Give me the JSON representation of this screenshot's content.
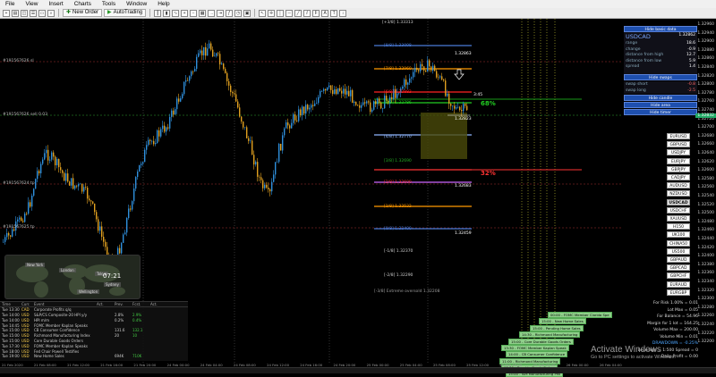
{
  "menu": [
    "File",
    "View",
    "Insert",
    "Charts",
    "Tools",
    "Window",
    "Help"
  ],
  "toolbar": {
    "new_order": "New Order",
    "autotrading": "AutoTrading"
  },
  "prices": [
    "1.32960",
    "1.32940",
    "1.32900",
    "1.32880",
    "1.32860",
    "1.32840",
    "1.32820",
    "1.32800",
    "1.32780",
    "1.32760",
    "1.32740",
    "1.32720",
    "1.32700",
    "1.32680",
    "1.32660",
    "1.32640",
    "1.32620",
    "1.32600",
    "1.32580",
    "1.32560",
    "1.32540",
    "1.32520",
    "1.32500",
    "1.32480",
    "1.32460",
    "1.32440",
    "1.32420",
    "1.32400",
    "1.32380",
    "1.32360",
    "1.32340",
    "1.32320",
    "1.32300",
    "1.32280",
    "1.32260",
    "1.32240",
    "1.32220",
    "1.32200"
  ],
  "current_price": "1.32832",
  "left_labels": [
    "#191567626 sl",
    "#191567626 sell 0.03",
    "#191567624 tp",
    "#191567625 tp"
  ],
  "fib": [
    {
      "label": "[+3/8] 1.33313",
      "color": "#cccccc"
    },
    {
      "label": "[8/8] 1.33098",
      "color": "#4a7bd8"
    },
    {
      "label": "1.32863",
      "color": "#ffffff"
    },
    {
      "label": "[7/8] 1.32960",
      "color": "#ff9900"
    },
    {
      "label": "[6/8] 1.32883",
      "color": "#ff2222"
    },
    {
      "label": "[5/8] 1.32786",
      "color": "#22cc22"
    },
    {
      "label": "1.32823",
      "color": "#ffffff"
    },
    {
      "label": "[4/8] 1.32770",
      "color": "#8fb7ff"
    },
    {
      "label": "[3/8] 1.32690",
      "color": "#22aa22"
    },
    {
      "label": "[2/8] 1.32600",
      "color": "#ff3333"
    },
    {
      "label": "1.32683",
      "color": "#ffffff"
    },
    {
      "label": "[1/8] 1.32522",
      "color": "#ff9900"
    },
    {
      "label": "[0/8] 1.32400",
      "color": "#4a7bd8"
    },
    {
      "label": "1.32459",
      "color": "#ffffff"
    },
    {
      "label": "[-1/8] 1.32370",
      "color": "#cccccc"
    },
    {
      "label": "[-2/8] 1.32290",
      "color": "#cccccc"
    },
    {
      "label": "[-3/8] Extreme oversold 1.32208",
      "color": "#999999"
    }
  ],
  "pct": {
    "top": "68%",
    "bottom": "32%",
    "time": "3:45"
  },
  "panel": {
    "hide_basic": "Hide basic data",
    "symbol": "USDCAD",
    "symbol_price": "1.32862",
    "rows": [
      {
        "k": "range",
        "v": "18.6"
      },
      {
        "k": "change",
        "v": "-0.9"
      },
      {
        "k": "distance from high",
        "v": "12.7"
      },
      {
        "k": "distance from low",
        "v": "5.9"
      },
      {
        "k": "spread",
        "v": "1.4"
      }
    ],
    "hide_swaps": "Hide swaps",
    "swaps": [
      {
        "k": "swap short",
        "v": "-0.8"
      },
      {
        "k": "swap long",
        "v": "-2.5"
      }
    ],
    "hide_candle": "Hide candle",
    "hide_area": "Hide area",
    "hide_timer": "Hide timer"
  },
  "symbols": [
    "EURUSD",
    "GBPUSD",
    "USDJPY",
    "EURJPY",
    "GBPJPY",
    "CADJPY",
    "AUDUSD",
    "NZDUSD",
    "USDCAD",
    "USDCHF",
    "XAUUSD",
    "H150",
    "UK100",
    "CHINA50",
    "US500",
    "GBPAUD",
    "GBPCAD",
    "GBPCHF",
    "EURAUD",
    "EURGBP"
  ],
  "info": [
    {
      "t": "For Risk 1.00% = 0.01",
      "c": "#dddddd"
    },
    {
      "t": "Lot Max = 0.05",
      "c": "#dddddd"
    },
    {
      "t": "For Balance = 54.96",
      "c": "#dddddd"
    },
    {
      "t": "Margin for 1 lot = 164.25",
      "c": "#dddddd"
    },
    {
      "t": "Volume Max = 200.00",
      "c": "#dddddd"
    },
    {
      "t": "Volume Min = 0.01",
      "c": "#dddddd"
    },
    {
      "t": "DRAWDOWN = -0.25%",
      "c": "#4da6ff"
    },
    {
      "t": "Leverage = 1:500 Spread = 0",
      "c": "#dddddd"
    },
    {
      "t": "Daily Profit = 0.00",
      "c": "#dddddd"
    }
  ],
  "green_boxes": [
    "00:00 - FOMC Member Clarida Spe",
    "15:00 - New Home Sales",
    "15:00 - Pending Home Sales",
    "14:30 - Richmond Manufacturing",
    "15:00 - Core Durable Goods Orders",
    "13:30 - FOMC Member Kaplan Speak",
    "14:00 - CB Consumer Confidence",
    "11:00 - Richmond Manufacturing",
    "13:30 - Durable Goods Orders",
    "15:00 - ISM Manufacturing PMI"
  ],
  "world": {
    "time": "07:21",
    "labels": [
      "New York",
      "London",
      "Tokyo",
      "Sydney",
      "Wellington"
    ]
  },
  "calendar": {
    "headers": [
      "Time",
      "Curr.",
      "Event",
      "Act.",
      "Prev.",
      "Fcst.",
      "Act."
    ],
    "rows": [
      [
        "Tue 13:30",
        "CAD",
        "Corporate Profits q/q",
        "",
        "",
        "",
        ""
      ],
      [
        "Tue 14:00",
        "USD",
        "S&P/CS Composite-20 HPI y/y",
        "",
        "2.8%",
        "2.9%",
        ""
      ],
      [
        "Tue 14:00",
        "USD",
        "HPI m/m",
        "",
        "0.2%",
        "0.4%",
        ""
      ],
      [
        "Tue 14:45",
        "USD",
        "FOMC Member Kaplan Speaks",
        "",
        "",
        "",
        ""
      ],
      [
        "Tue 15:00",
        "USD",
        "CB Consumer Confidence",
        "",
        "131.6",
        "132.1",
        ""
      ],
      [
        "Tue 15:00",
        "USD",
        "Richmond Manufacturing Index",
        "",
        "20",
        "10",
        ""
      ],
      [
        "Tue 15:00",
        "USD",
        "Core Durable Goods Orders",
        "",
        "",
        "",
        ""
      ],
      [
        "Tue 17:30",
        "USD",
        "FOMC Member Kaplan Speaks",
        "",
        "",
        "",
        ""
      ],
      [
        "Tue 18:00",
        "USD",
        "Fed Chair Powell Testifies",
        "",
        "",
        "",
        ""
      ],
      [
        "Tue 19:00",
        "USD",
        "New Home Sales",
        "",
        "694K",
        "710K",
        ""
      ]
    ]
  },
  "time_axis": [
    "21 Feb 2020",
    "21 Feb 08:00",
    "21 Feb 12:00",
    "21 Feb 16:00",
    "21 Feb 20:00",
    "24 Feb 00:00",
    "24 Feb 04:00",
    "24 Feb 08:00",
    "24 Feb 12:00",
    "24 Feb 16:00",
    "24 Feb 20:00",
    "25 Feb 00:00",
    "25 Feb 04:00",
    "25 Feb 08:00",
    "25 Feb 12:00",
    "25 Feb 16:00",
    "25 Feb 20:00",
    "26 Feb 00:00",
    "26 Feb 04:00"
  ],
  "watermark": {
    "title": "Activate Windows",
    "sub": "Go to PC settings to activate Windows."
  }
}
